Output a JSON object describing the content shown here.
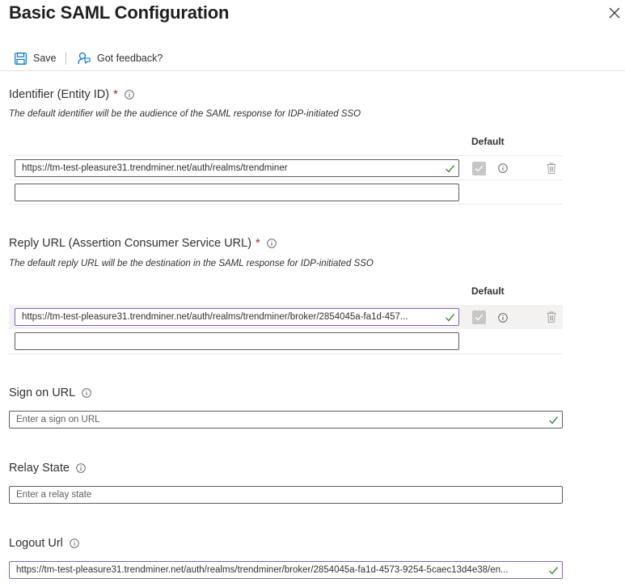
{
  "panel": {
    "title": "Basic SAML Configuration"
  },
  "toolbar": {
    "save_label": "Save",
    "feedback_label": "Got feedback?"
  },
  "identifier": {
    "label": "Identifier (Entity ID)",
    "required_mark": "*",
    "description": "The default identifier will be the audience of the SAML response for IDP-initiated SSO",
    "default_header": "Default",
    "rows": [
      {
        "value": "https://tm-test-pleasure31.trendminer.net/auth/realms/trendminer",
        "default_checked": true
      },
      {
        "value": ""
      }
    ]
  },
  "reply_url": {
    "label": "Reply URL (Assertion Consumer Service URL)",
    "required_mark": "*",
    "description": "The default reply URL will be the destination in the SAML response for IDP-initiated SSO",
    "default_header": "Default",
    "rows": [
      {
        "value": "https://tm-test-pleasure31.trendminer.net/auth/realms/trendminer/broker/2854045a-fa1d-457...",
        "default_checked": true
      },
      {
        "value": ""
      }
    ]
  },
  "sign_on_url": {
    "label": "Sign on URL",
    "placeholder": "Enter a sign on URL"
  },
  "relay_state": {
    "label": "Relay State",
    "placeholder": "Enter a relay state"
  },
  "logout_url": {
    "label": "Logout Url",
    "value": "https://tm-test-pleasure31.trendminer.net/auth/realms/trendminer/broker/2854045a-fa1d-4573-9254-5caec13d4e38/en..."
  },
  "colors": {
    "accent": "#0078d4",
    "required": "#a4262c",
    "valid_check": "#107c10",
    "focus_border": "#8764b8"
  }
}
